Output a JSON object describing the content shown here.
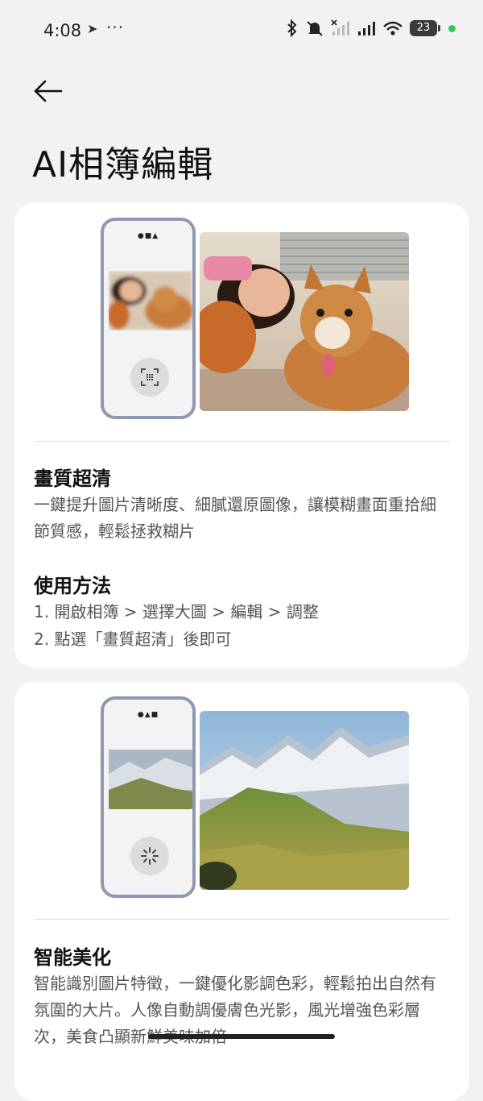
{
  "status_bar": {
    "time": "4:08",
    "nav_glyph": "➤",
    "more": "···",
    "battery": "23",
    "icons": [
      "bluetooth-icon",
      "mute-icon",
      "signal-sim1-icon",
      "signal-sim2-icon",
      "wifi-icon",
      "battery-icon"
    ],
    "dot_color": "#30c85a"
  },
  "header": {
    "back_icon": "back-arrow-icon",
    "title": "AI相簿編輯"
  },
  "cards": [
    {
      "title": "畫質超清",
      "description": "一鍵提升圖片清晰度、細膩還原圖像，讓模糊畫面重拾細節質感，輕鬆拯救糊片",
      "usage_title": "使用方法",
      "steps": [
        "1. 開啟相簿 > 選擇大圖 > 編輯 > 調整",
        "2. 點選「畫質超清」後即可"
      ],
      "phone_button_icon": "focus-scan-icon"
    },
    {
      "title": "智能美化",
      "description": "智能識別圖片特徵，一鍵優化影調色彩，輕鬆拍出自然有氛圍的大片。人像自動調優膚色光影，風光增強色彩層次，美食凸顯新鮮美味加倍",
      "phone_button_icon": "sparkle-loading-icon"
    }
  ],
  "colors": {
    "background": "#f2f2f4",
    "card": "#ffffff",
    "phone_frame": "#8f98b2"
  }
}
